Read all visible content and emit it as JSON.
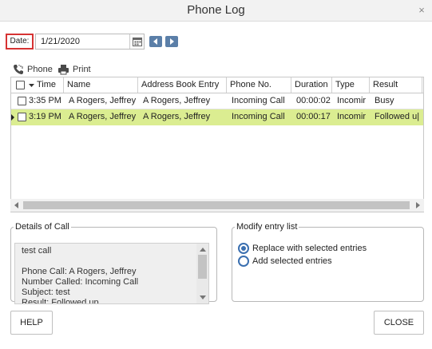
{
  "window": {
    "title": "Phone Log",
    "close_glyph": "×"
  },
  "date": {
    "label": "Date:",
    "value": "1/21/2020"
  },
  "toolbar": {
    "phone_label": "Phone",
    "print_label": "Print"
  },
  "grid": {
    "columns": [
      "Time",
      "Name",
      "Address Book Entry",
      "Phone No.",
      "Duration",
      "Type",
      "Result"
    ],
    "rows": [
      {
        "time": "3:35 PM",
        "name": "A Rogers, Jeffrey",
        "address_book_entry": "A Rogers, Jeffrey",
        "phone_no": "Incoming Call",
        "duration": "00:00:02",
        "type": "Incomir",
        "result": "Busy",
        "selected": false
      },
      {
        "time": "3:19 PM",
        "name": "A Rogers, Jeffrey",
        "address_book_entry": "A Rogers, Jeffrey",
        "phone_no": "Incoming Call",
        "duration": "00:00:17",
        "type": "Incomir",
        "result": "Followed u|",
        "selected": true
      }
    ]
  },
  "details": {
    "legend": "Details of Call",
    "line1": "test call",
    "line2": "",
    "line3": "Phone Call: A Rogers, Jeffrey",
    "line4": "Number Called: Incoming Call",
    "line5": "Subject: test",
    "line6": "Result: Followed up"
  },
  "modify": {
    "legend": "Modify entry list",
    "option_replace": "Replace with selected entries",
    "option_add": "Add selected entries"
  },
  "buttons": {
    "help": "HELP",
    "close": "CLOSE"
  },
  "colors": {
    "selected_row": "#dbed91",
    "accent": "#3a6fb0",
    "date_highlight": "#d63333",
    "nav_button": "#5b7fa8"
  }
}
